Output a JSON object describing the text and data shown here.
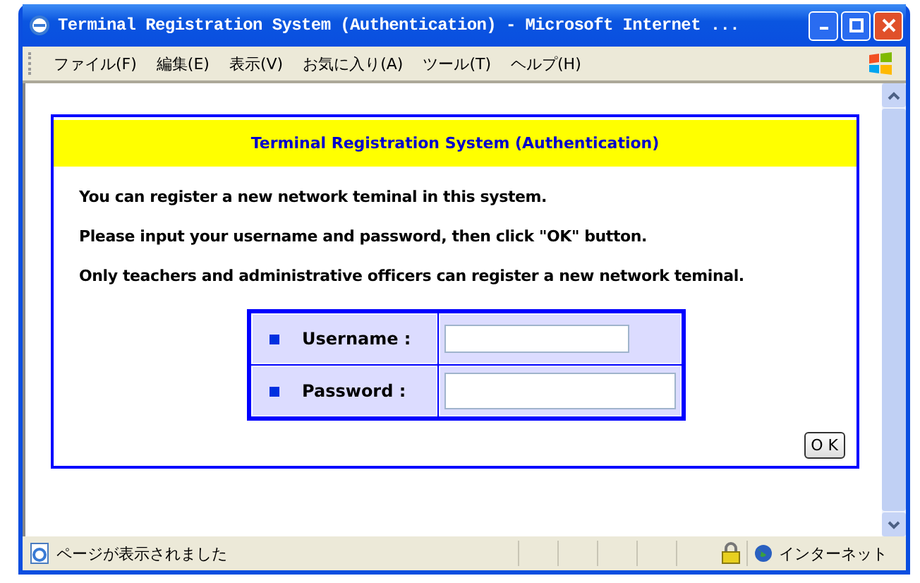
{
  "window": {
    "title": "Terminal Registration System (Authentication) - Microsoft Internet ..."
  },
  "menu": [
    "ファイル(F)",
    "編集(E)",
    "表示(V)",
    "お気に入り(A)",
    "ツール(T)",
    "ヘルプ(H)"
  ],
  "panel": {
    "heading": "Terminal Registration System (Authentication)",
    "paragraphs": [
      "You can register a new network teminal in this system.",
      "Please input your username and password, then click \"OK\" button.",
      "Only teachers and administrative officers can register a new network teminal."
    ],
    "fields": [
      {
        "label": "Username :",
        "kind": "text"
      },
      {
        "label": "Password :",
        "kind": "password"
      }
    ],
    "ok_button": "O K"
  },
  "status_bar": {
    "message": "ページが表示されました",
    "zone": "インターネット"
  }
}
